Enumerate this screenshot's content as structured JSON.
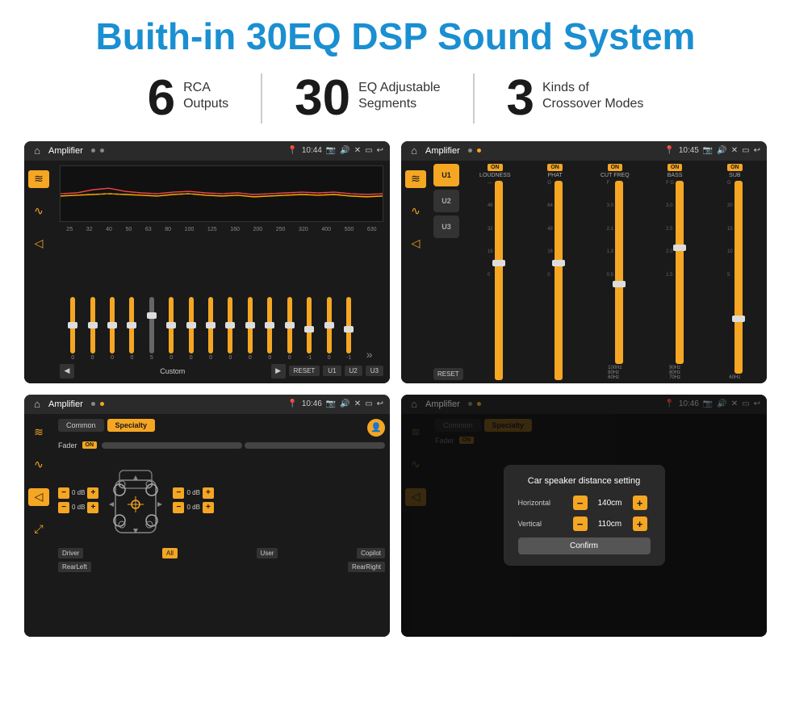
{
  "page": {
    "title": "Buith-in 30EQ DSP Sound System"
  },
  "stats": [
    {
      "number": "6",
      "line1": "RCA",
      "line2": "Outputs"
    },
    {
      "number": "30",
      "line1": "EQ Adjustable",
      "line2": "Segments"
    },
    {
      "number": "3",
      "line1": "Kinds of",
      "line2": "Crossover Modes"
    }
  ],
  "screens": [
    {
      "id": "eq-screen",
      "app_name": "Amplifier",
      "time": "10:44",
      "eq_labels": [
        "25",
        "32",
        "40",
        "50",
        "63",
        "80",
        "100",
        "125",
        "160",
        "200",
        "250",
        "320",
        "400",
        "500",
        "630"
      ],
      "eq_values": [
        "0",
        "0",
        "0",
        "0",
        "5",
        "0",
        "0",
        "0",
        "0",
        "0",
        "0",
        "0",
        "-1",
        "0",
        "-1"
      ],
      "preset": "Custom",
      "buttons": [
        "RESET",
        "U1",
        "U2",
        "U3"
      ]
    },
    {
      "id": "crossover-screen",
      "app_name": "Amplifier",
      "time": "10:45",
      "units": [
        "U1",
        "U2",
        "U3"
      ],
      "params": [
        "LOUDNESS",
        "PHAT",
        "CUT FREQ",
        "BASS",
        "SUB"
      ],
      "reset_label": "RESET"
    },
    {
      "id": "fader-screen",
      "app_name": "Amplifier",
      "time": "10:46",
      "tabs": [
        "Common",
        "Specialty"
      ],
      "fader_label": "Fader",
      "on_label": "ON",
      "speakers": {
        "left_top": "0 dB",
        "left_bottom": "0 dB",
        "right_top": "0 dB",
        "right_bottom": "0 dB"
      },
      "bottom_buttons": [
        "Driver",
        "All",
        "User",
        "Copilot",
        "RearLeft",
        "RearRight"
      ]
    },
    {
      "id": "dialog-screen",
      "app_name": "Amplifier",
      "time": "10:46",
      "dialog": {
        "title": "Car speaker distance setting",
        "horizontal_label": "Horizontal",
        "horizontal_value": "140cm",
        "vertical_label": "Vertical",
        "vertical_value": "110cm",
        "confirm_label": "Confirm"
      }
    }
  ],
  "icons": {
    "home": "⌂",
    "back": "↩",
    "eq_icon": "≋",
    "wave_icon": "∿",
    "speaker_icon": "◁",
    "expand_icon": "⤢",
    "location": "📍",
    "camera": "📷",
    "volume": "🔊",
    "close": "✕"
  }
}
